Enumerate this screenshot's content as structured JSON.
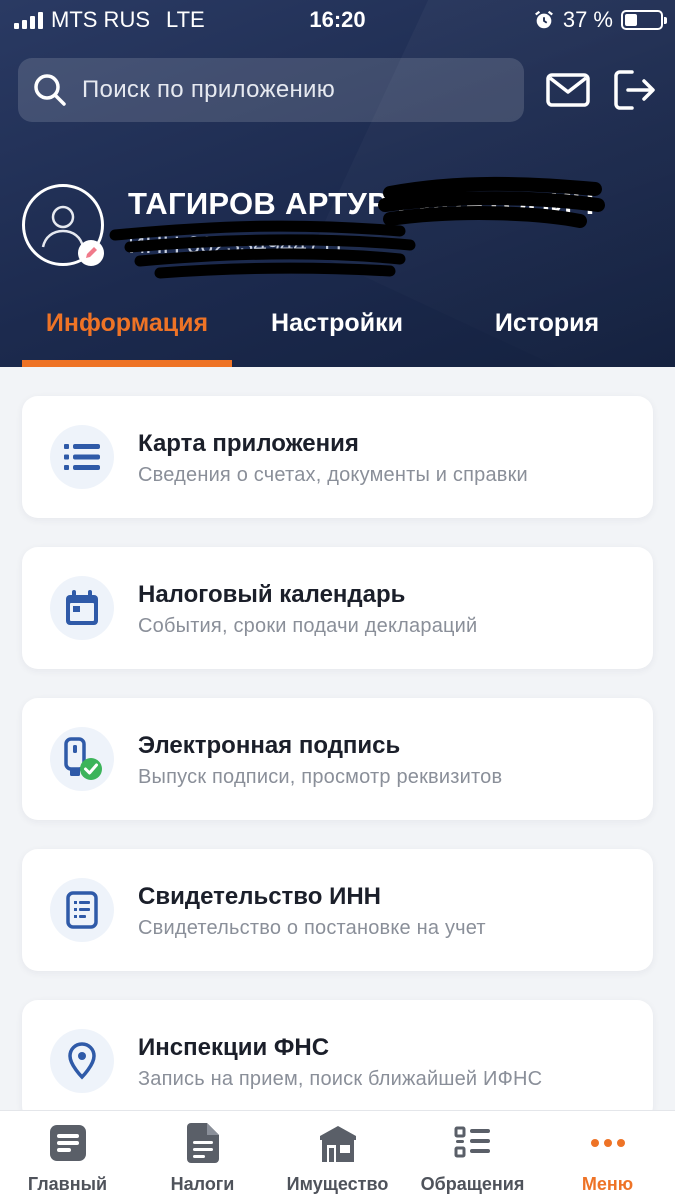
{
  "status_bar": {
    "carrier": "MTS RUS",
    "network": "LTE",
    "time": "16:20",
    "battery": "37 %"
  },
  "search": {
    "placeholder": "Поиск по приложению"
  },
  "profile": {
    "name": "ТАГИРОВ АРТУР РИНАТОВИЧ",
    "inn": "ИНН 662334944711"
  },
  "tabs": [
    {
      "label": "Информация",
      "active": true
    },
    {
      "label": "Настройки",
      "active": false
    },
    {
      "label": "История",
      "active": false
    }
  ],
  "cards": [
    {
      "title": "Карта приложения",
      "subtitle": "Сведения о счетах, документы и справки",
      "icon": "list-icon"
    },
    {
      "title": "Налоговый календарь",
      "subtitle": "События, сроки подачи деклараций",
      "icon": "calendar-icon"
    },
    {
      "title": "Электронная подпись",
      "subtitle": "Выпуск подписи, просмотр реквизитов",
      "icon": "token-check-icon"
    },
    {
      "title": "Свидетельство ИНН",
      "subtitle": "Свидетельство о постановке на учет",
      "icon": "document-icon"
    },
    {
      "title": "Инспекции ФНС",
      "subtitle": "Запись на прием, поиск ближайшей ИФНС",
      "icon": "location-pin-icon"
    }
  ],
  "bottom_nav": [
    {
      "label": "Главный",
      "icon": "home-doc-icon",
      "active": false
    },
    {
      "label": "Налоги",
      "icon": "tax-doc-icon",
      "active": false
    },
    {
      "label": "Имущество",
      "icon": "property-icon",
      "active": false
    },
    {
      "label": "Обращения",
      "icon": "requests-icon",
      "active": false
    },
    {
      "label": "Меню",
      "icon": "more-dots-icon",
      "active": true
    }
  ],
  "colors": {
    "accent": "#ee7326",
    "header_bg": "#1c2a4e",
    "icon_blue": "#2f5aa8",
    "check_green": "#3cb45a"
  }
}
